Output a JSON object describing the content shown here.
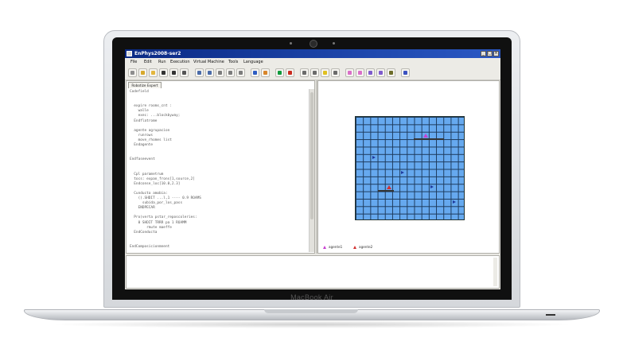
{
  "window": {
    "title": "EnPhys2008-ser2",
    "buttons": [
      "_",
      "□",
      "×"
    ]
  },
  "menu": [
    "File",
    "Edit",
    "Run",
    "Execution",
    "Virtual Machine",
    "Tools",
    "Language"
  ],
  "toolbar": [
    {
      "icon": "new-file-icon",
      "color": "#8e8e8e"
    },
    {
      "icon": "open-folder-icon",
      "color": "#d7a92c"
    },
    {
      "icon": "folder-icon",
      "color": "#e3b63d"
    },
    {
      "icon": "save-icon",
      "color": "#333333"
    },
    {
      "icon": "save-all-icon",
      "color": "#333333"
    },
    {
      "icon": "print-icon",
      "color": "#555555"
    },
    {
      "icon": "undo-icon",
      "color": "#4a6ba8"
    },
    {
      "icon": "redo-icon",
      "color": "#4a6ba8"
    },
    {
      "icon": "copy-icon",
      "color": "#7c7c7c"
    },
    {
      "icon": "paste-icon",
      "color": "#7c7c7c"
    },
    {
      "icon": "cut-icon",
      "color": "#7c7c7c"
    },
    {
      "icon": "run-icon",
      "color": "#2e5dc2"
    },
    {
      "icon": "compile-icon",
      "color": "#d8862a"
    },
    {
      "icon": "start-icon",
      "color": "#0f9a3c"
    },
    {
      "icon": "stop-icon",
      "color": "#c92a1e"
    },
    {
      "icon": "draw-icon",
      "color": "#6b6b6b"
    },
    {
      "icon": "inspect-icon",
      "color": "#6b6b6b"
    },
    {
      "icon": "bulb-icon",
      "color": "#e0c020"
    },
    {
      "icon": "search-icon",
      "color": "#6b6b6b"
    },
    {
      "icon": "arrow-right-icon",
      "color": "#d96fc8"
    },
    {
      "icon": "arrow-left-icon",
      "color": "#d96fc8"
    },
    {
      "icon": "agent-icon",
      "color": "#7f5ccc"
    },
    {
      "icon": "pen-icon",
      "color": "#7f5ccc"
    },
    {
      "icon": "person-icon",
      "color": "#6d6d2a"
    },
    {
      "icon": "book-icon",
      "color": "#3b52c0"
    }
  ],
  "editor": {
    "tab_label": "Robotize Expert",
    "code": "Codefield\n\n\n  expire rooms_cnt :\n    walle\n    exec: ...blockbyway;\n  Endflatrome\n\n  agente agrupacion\n    runrows\n    move_rhomes list\n  Endagente\n\n\nEndfaseevent\n\n\n  Cpl parametrum\n  tocs: expan_frons[1,source,2]\n  Endconse_loc[10.0,2.3]\n\n  Cunducta amobia:\n    ((.SHDIT ...l,1 ---- 0.9 ROAMS\n      subida_por_los_pass\n    ENDPECAR\n\n  Pro(verta pstar_reposcoleries:\n    0 SHDIT TRRR pa 1 ROAMM\n        rmute maeffe\n  EndConducta\n\n\nEndComposicionmnent\n\n\n  Modelo...\n    dc_Euroler:  in 1 pass;\n      Ruedas"
  },
  "grid": {
    "cols": 15,
    "rows": 14,
    "agents": [
      {
        "col": 9,
        "row": 2,
        "color": "#c83fd0",
        "type": "agent-1"
      },
      {
        "col": 4,
        "row": 9,
        "color": "#d23030",
        "type": "agent-2"
      },
      {
        "col": 2,
        "row": 5,
        "color": "#1e3a9e",
        "type": "robot"
      },
      {
        "col": 6,
        "row": 7,
        "color": "#1e3a9e",
        "type": "robot"
      },
      {
        "col": 10,
        "row": 9,
        "color": "#1e3a9e",
        "type": "robot"
      },
      {
        "col": 13,
        "row": 11,
        "color": "#1e3a9e",
        "type": "robot"
      }
    ]
  },
  "legend": [
    {
      "label": "agente1",
      "color": "#c83fd0"
    },
    {
      "label": "agente2",
      "color": "#d23030"
    }
  ],
  "laptop": {
    "brand": "MacBook Air"
  }
}
